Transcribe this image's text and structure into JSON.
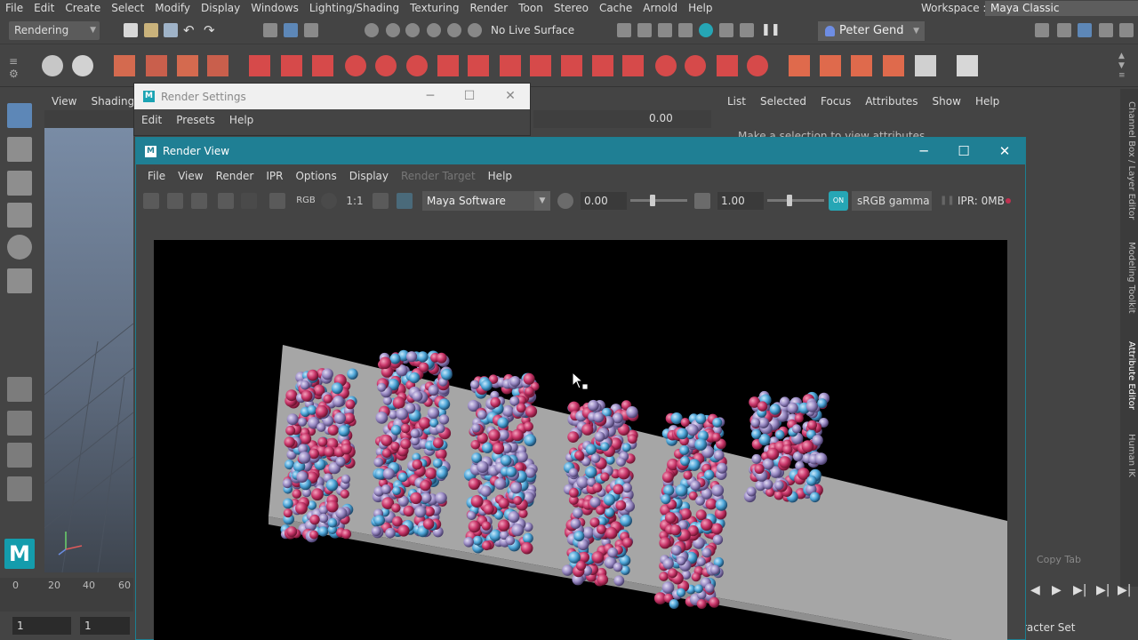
{
  "main_menu": [
    "File",
    "Edit",
    "Create",
    "Select",
    "Modify",
    "Display",
    "Windows",
    "Lighting/Shading",
    "Texturing",
    "Render",
    "Toon",
    "Stereo",
    "Cache",
    "Arnold",
    "Help"
  ],
  "workspace": {
    "label": "Workspace :",
    "value": "Maya Classic"
  },
  "status_line": {
    "menu_set": "Rendering",
    "live_surface": "No Live Surface",
    "user": "Peter Gend"
  },
  "viewport": {
    "menu": [
      "View",
      "Shading"
    ],
    "field_value": "0.00"
  },
  "attribute_editor": {
    "menu": [
      "List",
      "Selected",
      "Focus",
      "Attributes",
      "Show",
      "Help"
    ],
    "note": "Make a selection to view attributes",
    "copy_tab": "Copy Tab",
    "side_tabs": [
      "Channel Box / Layer Editor",
      "Modeling Toolkit",
      "Attribute Editor",
      "Human IK"
    ],
    "character_set": "racter Set"
  },
  "timeline": {
    "ticks": [
      "0",
      "20",
      "40",
      "60"
    ],
    "start_field": "1",
    "current_field": "1"
  },
  "render_settings": {
    "title": "Render Settings",
    "menu": [
      "Edit",
      "Presets",
      "Help"
    ]
  },
  "render_view": {
    "title": "Render View",
    "menu": [
      "File",
      "View",
      "Render",
      "IPR",
      "Options",
      "Display",
      "Render Target",
      "Help"
    ],
    "disabled_menu": "Render Target",
    "rgb_label": "RGB",
    "ratio_label": "1:1",
    "renderer": "Maya Software",
    "exposure": "0.00",
    "gamma": "1.00",
    "color_mgmt_toggle": "ON",
    "view_transform": "sRGB gamma",
    "ipr_memory": "IPR: 0MB"
  },
  "colors": {
    "accent": "#1f7f94",
    "pink_ball": "#c9366a",
    "blue_ball": "#4ea6d8",
    "lilac_ball": "#9a8bc4"
  }
}
